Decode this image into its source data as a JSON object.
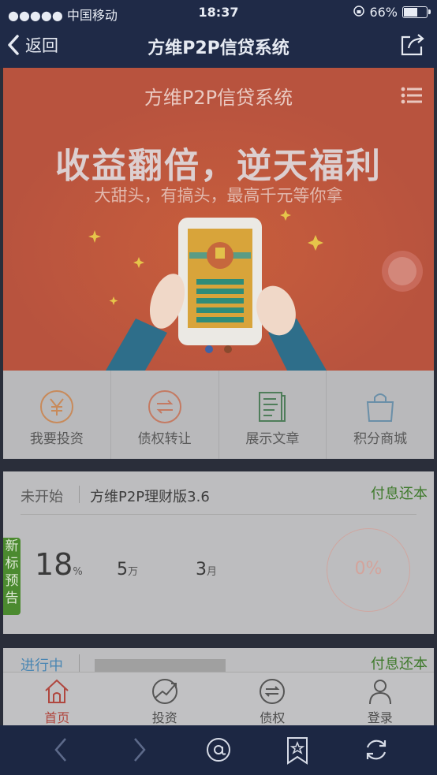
{
  "status_bar": {
    "carrier": "●●●●● 中国移动",
    "time": "18:37",
    "battery": "66%",
    "battery_level": 0.66
  },
  "nav": {
    "back_label": "返回",
    "title": "方维P2P信贷系统"
  },
  "banner": {
    "site_title": "方维P2P信贷系统",
    "headline": "收益翻倍，逆天福利",
    "subline": "大甜头，有搞头，最高千元等你拿",
    "slide_count": 2,
    "active_slide": 1
  },
  "quick_menu": [
    {
      "label": "我要投资",
      "icon": "yuan-coin-icon"
    },
    {
      "label": "债权转让",
      "icon": "transfer-icon"
    },
    {
      "label": "展示文章",
      "icon": "article-icon"
    },
    {
      "label": "积分商城",
      "icon": "shopping-bag-icon"
    }
  ],
  "loans": [
    {
      "status": "未开始",
      "name": "方维P2P理财版3.6",
      "repay_type": "付息还本",
      "rate": "18",
      "rate_unit": "%",
      "amount": "5",
      "amount_unit": "万",
      "term": "3",
      "term_unit": "月",
      "progress": "0%",
      "tag": "新标预告"
    },
    {
      "status": "进行中",
      "repay_type": "付息还本"
    }
  ],
  "tabbar": [
    {
      "label": "首页",
      "icon": "home-icon",
      "active": true
    },
    {
      "label": "投资",
      "icon": "invest-chart-icon",
      "active": false
    },
    {
      "label": "债权",
      "icon": "transfer-icon",
      "active": false
    },
    {
      "label": "登录",
      "icon": "user-icon",
      "active": false
    }
  ],
  "colors": {
    "nav_bg": "#1f2a47",
    "banner_bg": "#b8533e",
    "accent_green": "#3f7a2c",
    "accent_red": "#b0473f",
    "tag_green": "#4b8a2f"
  }
}
